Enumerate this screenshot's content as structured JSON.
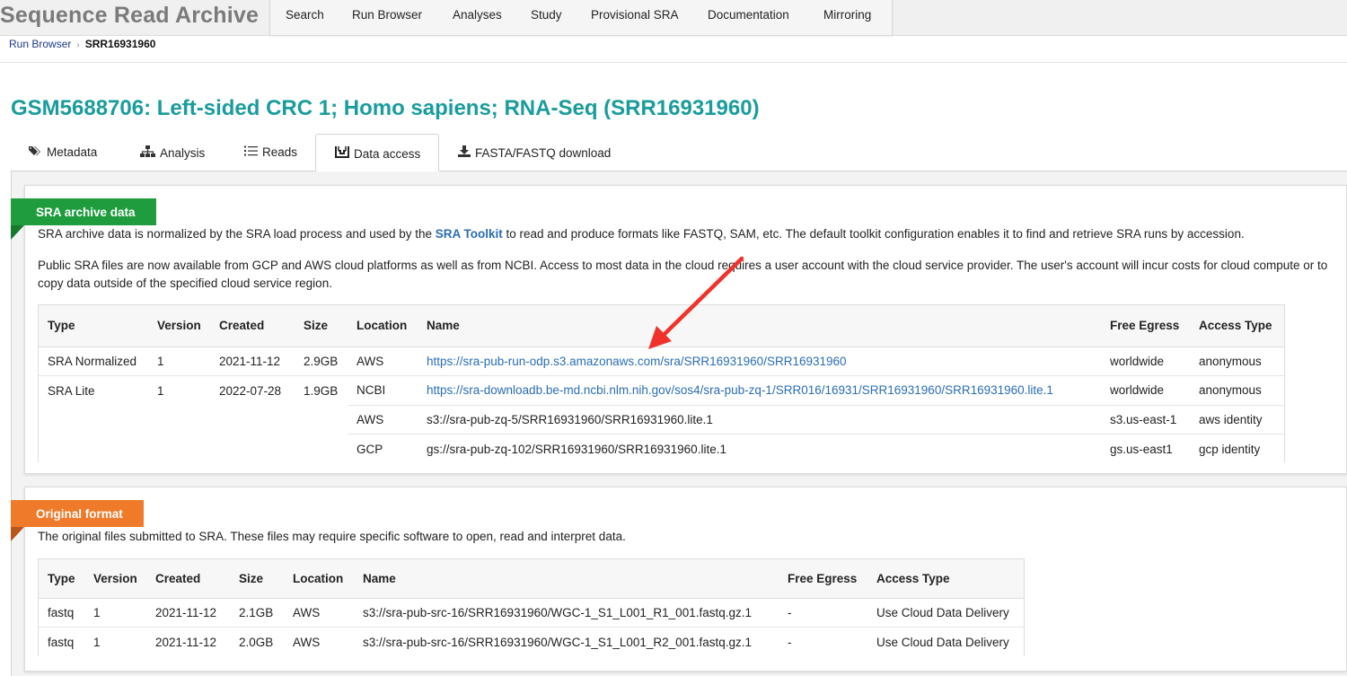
{
  "header": {
    "app_title": "Sequence Read Archive",
    "nav": [
      "Search",
      "Run Browser",
      "Analyses",
      "Study",
      "Provisional SRA",
      "Documentation",
      "Mirroring"
    ]
  },
  "breadcrumb": {
    "parent": "Run Browser",
    "current": "SRR16931960"
  },
  "page_title": "GSM5688706: Left-sided CRC 1; Homo sapiens; RNA-Seq (SRR16931960)",
  "tabs": [
    {
      "label": "Metadata",
      "icon": "tags-icon"
    },
    {
      "label": "Analysis",
      "icon": "sitemap-icon"
    },
    {
      "label": "Reads",
      "icon": "list-icon"
    },
    {
      "label": "Data access",
      "icon": "inbox-icon",
      "active": true
    },
    {
      "label": "FASTA/FASTQ download",
      "icon": "download-icon"
    }
  ],
  "sra_archive": {
    "ribbon": "SRA archive data",
    "desc1_pre": "SRA archive data is normalized by the SRA load process and used by the ",
    "desc1_link": "SRA Toolkit",
    "desc1_post": " to read and produce formats like FASTQ, SAM, etc. The default toolkit configuration enables it to find and retrieve SRA runs by accession.",
    "desc2": "Public SRA files are now available from GCP and AWS cloud platforms as well as from NCBI. Access to most data in the cloud requires a user account with the cloud service provider. The user's account will incur costs for cloud compute or to copy data outside of the specified cloud service region.",
    "columns": [
      "Type",
      "Version",
      "Created",
      "Size",
      "Location",
      "Name",
      "Free Egress",
      "Access Type"
    ],
    "rows": [
      {
        "type": "SRA Normalized",
        "version": "1",
        "created": "2021-11-12",
        "size": "2.9GB",
        "location": "AWS",
        "name": "https://sra-pub-run-odp.s3.amazonaws.com/sra/SRR16931960/SRR16931960",
        "name_is_link": true,
        "egress": "worldwide",
        "access": "anonymous"
      },
      {
        "type": "SRA Lite",
        "version": "1",
        "created": "2022-07-28",
        "size": "1.9GB",
        "location": "NCBI",
        "name": "https://sra-downloadb.be-md.ncbi.nlm.nih.gov/sos4/sra-pub-zq-1/SRR016/16931/SRR16931960/SRR16931960.lite.1",
        "name_is_link": true,
        "egress": "worldwide",
        "access": "anonymous"
      },
      {
        "type": "",
        "version": "",
        "created": "",
        "size": "",
        "location": "AWS",
        "name": "s3://sra-pub-zq-5/SRR16931960/SRR16931960.lite.1",
        "name_is_link": false,
        "egress": "s3.us-east-1",
        "access": "aws identity"
      },
      {
        "type": "",
        "version": "",
        "created": "",
        "size": "",
        "location": "GCP",
        "name": "gs://sra-pub-zq-102/SRR16931960/SRR16931960.lite.1",
        "name_is_link": false,
        "egress": "gs.us-east1",
        "access": "gcp identity"
      }
    ]
  },
  "original_format": {
    "ribbon": "Original format",
    "desc": "The original files submitted to SRA. These files may require specific software to open, read and interpret data.",
    "columns": [
      "Type",
      "Version",
      "Created",
      "Size",
      "Location",
      "Name",
      "Free Egress",
      "Access Type"
    ],
    "rows": [
      {
        "type": "fastq",
        "version": "1",
        "created": "2021-11-12",
        "size": "2.1GB",
        "location": "AWS",
        "name": "s3://sra-pub-src-16/SRR16931960/WGC-1_S1_L001_R1_001.fastq.gz.1",
        "egress": "-",
        "access": "Use Cloud Data Delivery"
      },
      {
        "type": "fastq",
        "version": "1",
        "created": "2021-11-12",
        "size": "2.0GB",
        "location": "AWS",
        "name": "s3://sra-pub-src-16/SRR16931960/WGC-1_S1_L001_R2_001.fastq.gz.1",
        "egress": "-",
        "access": "Use Cloud Data Delivery"
      }
    ]
  },
  "colors": {
    "title": "#1a9c9c",
    "green_ribbon": "#1f9d3e",
    "orange_ribbon": "#ee7a2a",
    "link": "#2a6db3",
    "annotation_arrow": "#f0322a"
  }
}
